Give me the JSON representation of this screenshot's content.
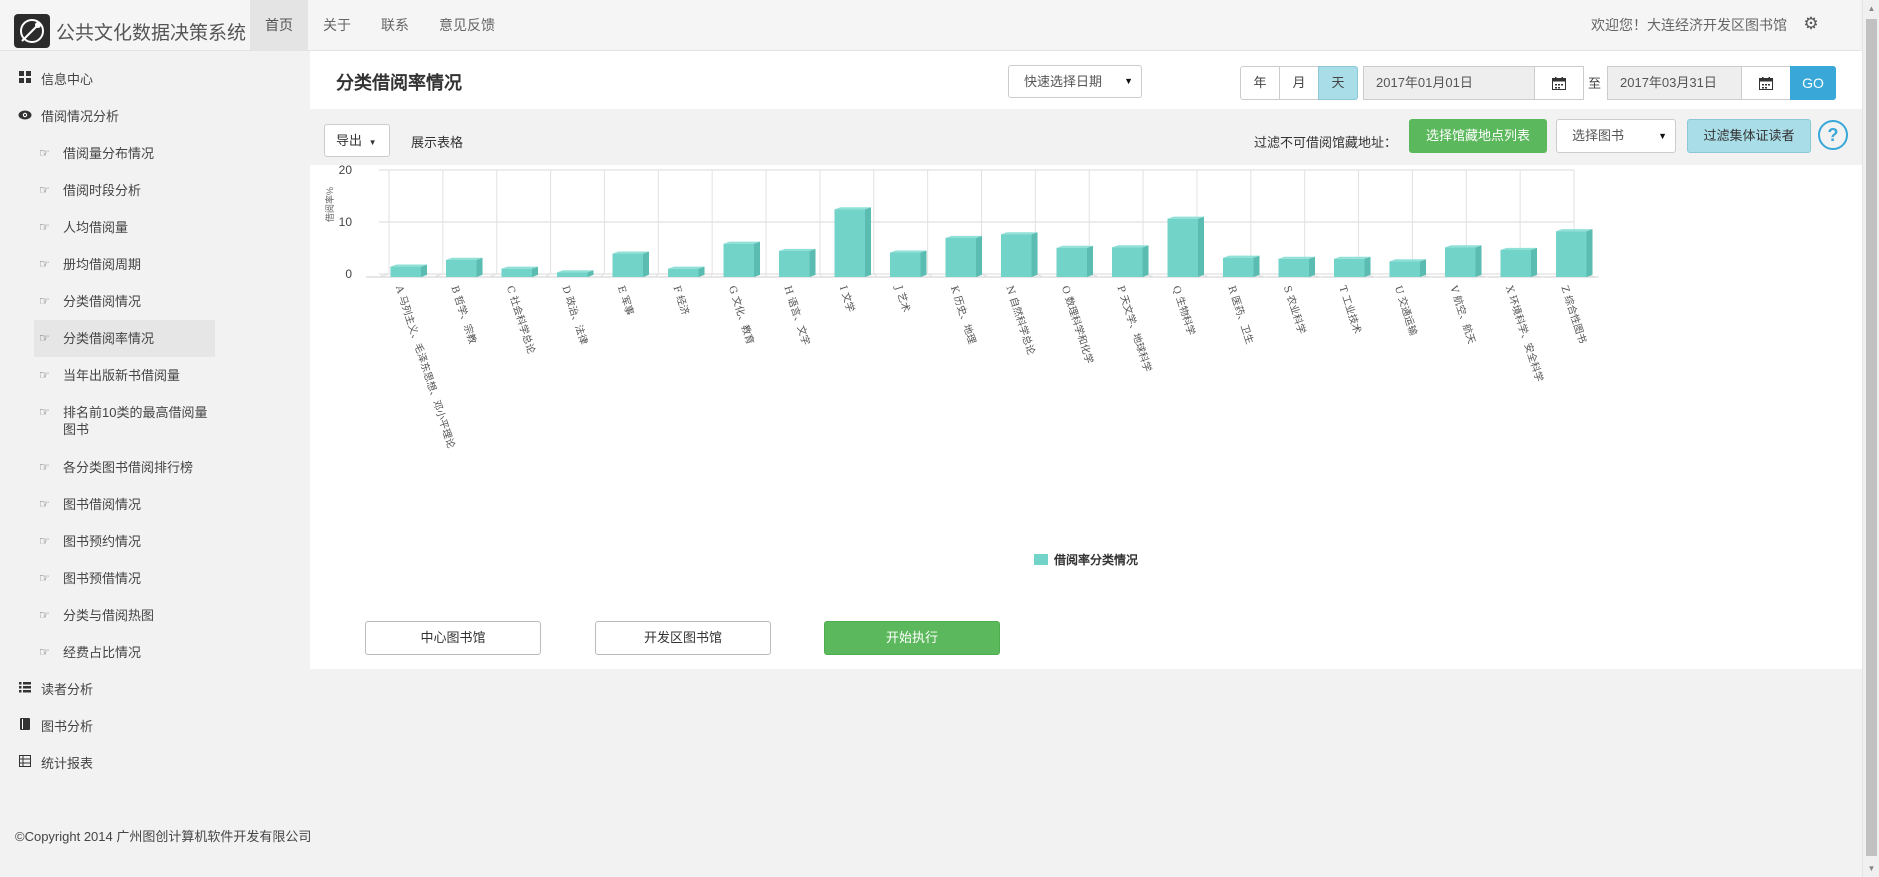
{
  "header": {
    "brand_title": "公共文化数据决策系统",
    "nav": [
      "首页",
      "关于",
      "联系",
      "意见反馈"
    ],
    "welcome": "欢迎您！大连经济开发区图书馆"
  },
  "sidebar": {
    "top_items": [
      {
        "label": "信息中心",
        "icon": "grid-icon"
      },
      {
        "label": "借阅情况分析",
        "icon": "eye-icon"
      }
    ],
    "sub_items": [
      "借阅量分布情况",
      "借阅时段分析",
      "人均借阅量",
      "册均借阅周期",
      "分类借阅情况",
      "分类借阅率情况",
      "当年出版新书借阅量",
      "排名前10类的最高借阅量图书",
      "各分类图书借阅排行榜",
      "图书借阅情况",
      "图书预约情况",
      "图书预借情况",
      "分类与借阅热图",
      "经费占比情况"
    ],
    "bottom_items": [
      {
        "label": "读者分析",
        "icon": "list-icon"
      },
      {
        "label": "图书分析",
        "icon": "book-icon"
      },
      {
        "label": "统计报表",
        "icon": "table-icon"
      }
    ],
    "active_sub": "分类借阅率情况"
  },
  "toolbar": {
    "page_title": "分类借阅率情况",
    "quick_select": "快速选择日期",
    "periods": [
      "年",
      "月",
      "天"
    ],
    "active_period": "天",
    "start_date": "2017年01月01日",
    "to_label": "至",
    "end_date": "2017年03月31日",
    "go_label": "GO"
  },
  "filters": {
    "export_label": "导出",
    "show_table_label": "展示表格",
    "filter_label": "过滤不可借阅馆藏地址：",
    "location_list_label": "选择馆藏地点列表",
    "select_book_label": "选择图书",
    "filter_collective_label": "过滤集体证读者",
    "help_glyph": "?"
  },
  "actions": {
    "center_library": "中心图书馆",
    "dev_zone_library": "开发区图书馆",
    "start_label": "开始执行"
  },
  "footer": {
    "copyright": "©Copyright 2014 广州图创计算机软件开发有限公司"
  },
  "colors": {
    "bar": "#72d3c9",
    "accent_green": "#5cb85c",
    "accent_blue": "#39a8d8"
  },
  "chart_data": {
    "type": "bar",
    "ylabel": "借阅率%",
    "ylim": [
      0,
      20
    ],
    "yticks": [
      0,
      10,
      20
    ],
    "legend": "借阅率分类情况",
    "legend_position": "bottom-center",
    "categories": [
      "A 马列主义、毛泽东思想、邓小平理论",
      "B 哲学、宗教",
      "C 社会科学总论",
      "D 政治、法律",
      "E 军事",
      "F 经济",
      "G 文化、教育",
      "H 语言、文字",
      "I 文学",
      "J 艺术",
      "K 历史、地理",
      "N 自然科学总论",
      "O 数理科学和化学",
      "P 天文学、地球科学",
      "Q 生物科学",
      "R 医药、卫生",
      "S 农业科学",
      "T 工业技术",
      "U 交通运输",
      "V 航空、航天",
      "X 环境科学、安全科学",
      "Z 综合性图书"
    ],
    "series": [
      {
        "name": "借阅率分类情况",
        "values": [
          2.0,
          3.3,
          1.6,
          0.9,
          4.5,
          1.6,
          6.4,
          5.0,
          13.0,
          4.7,
          7.5,
          8.2,
          5.6,
          5.7,
          11.2,
          3.7,
          3.5,
          3.5,
          3.0,
          5.7,
          5.2,
          8.8
        ]
      }
    ]
  }
}
